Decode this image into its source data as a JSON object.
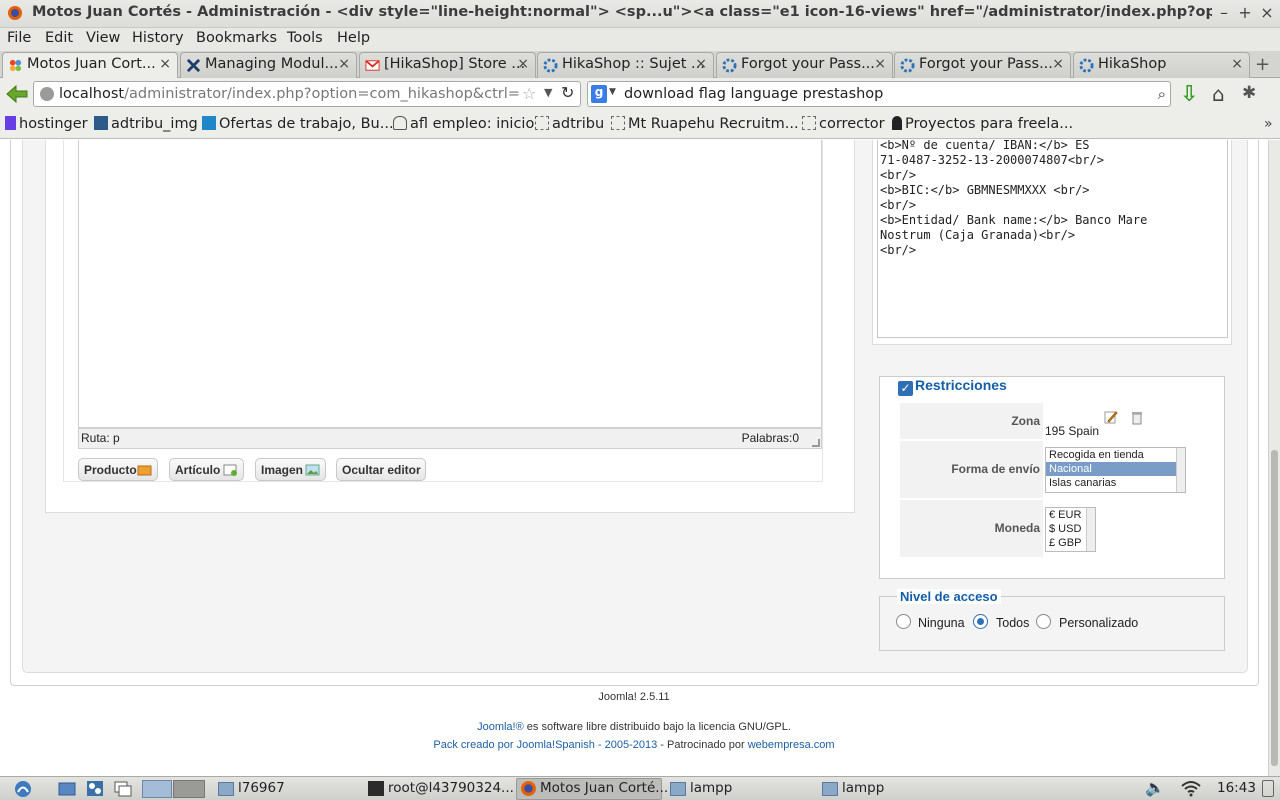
{
  "window": {
    "title": "Motos Juan Cortés - Administración - <div style=\"line-height:normal\"> <sp...u\"><a class=\"e1 icon-16-views\" href=\"/administrator/index.php?option=co",
    "minimize": "–",
    "maximize": "+",
    "close": "×"
  },
  "menu": [
    "File",
    "Edit",
    "View",
    "History",
    "Bookmarks",
    "Tools",
    "Help"
  ],
  "tabs": [
    {
      "label": "Motos Juan Cort...",
      "icon": "joomla-icon",
      "active": true
    },
    {
      "label": "Managing Modul...",
      "icon": "joomla-icon",
      "active": false
    },
    {
      "label": "[HikaShop] Store ...",
      "icon": "gmail-icon",
      "active": false
    },
    {
      "label": "HikaShop :: Sujet ...",
      "icon": "hikashop-icon",
      "active": false
    },
    {
      "label": "Forgot your Pass...",
      "icon": "hikashop-icon",
      "active": false
    },
    {
      "label": "Forgot your Pass...",
      "icon": "hikashop-icon",
      "active": false
    },
    {
      "label": "HikaShop",
      "icon": "hikashop-icon",
      "active": false
    }
  ],
  "tab_close": "×",
  "new_tab": "+",
  "nav": {
    "url_host": "localhost",
    "url_path": "/administrator/index.php?option=com_hikashop&ctrl=plug",
    "search_query": "download flag language prestashop",
    "search_engine": "g"
  },
  "bookmarks": [
    {
      "label": "hostinger",
      "icon": "hostinger-icon"
    },
    {
      "label": "adtribu_img",
      "icon": "adtribu-icon"
    },
    {
      "label": "Ofertas de trabajo, Bu...",
      "icon": "infojobs-icon"
    },
    {
      "label": "afl empleo: inicio",
      "icon": "chef-hat-icon"
    },
    {
      "label": "adtribu",
      "icon": "page-icon"
    },
    {
      "label": "Mt Ruapehu Recruitm...",
      "icon": "page-icon"
    },
    {
      "label": "corrector",
      "icon": "page-icon"
    },
    {
      "label": "Proyectos para freela...",
      "icon": "workana-icon"
    }
  ],
  "editor": {
    "path_label": "Ruta: p",
    "words_label": "Palabras:0",
    "buttons": [
      {
        "label": "Producto",
        "icon": "package-icon"
      },
      {
        "label": "Artículo",
        "icon": "article-icon"
      },
      {
        "label": "Imagen",
        "icon": "image-icon"
      },
      {
        "label": "Ocultar editor",
        "icon": ""
      }
    ]
  },
  "payment_info_code": "<br/>\n<b>Nº de cuenta/ IBAN:</b> ES\n71-0487-3252-13-2000074807<br/>\n<br/>\n<b>BIC:</b> GBMNESMMXXX <br/>\n<br/>\n<b>Entidad/ Bank name:</b> Banco Mare\nNostrum (Caja Granada)<br/>\n<br/>",
  "restricciones": {
    "title": "Restricciones",
    "checked": true,
    "zona_label": "Zona",
    "zona_value": "195 Spain",
    "forma_label": "Forma de envío",
    "forma_options": [
      "Recogida en tienda",
      "Nacional",
      "Islas canarias"
    ],
    "forma_selected": "Nacional",
    "moneda_label": "Moneda",
    "moneda_options": [
      "€ EUR",
      "$ USD",
      "£ GBP"
    ]
  },
  "nivel_acceso": {
    "title": "Nivel de acceso",
    "options": [
      "Ninguna",
      "Todos",
      "Personalizado"
    ],
    "selected": "Todos"
  },
  "footer": {
    "version": "Joomla! 2.5.11",
    "license_link": "Joomla!®",
    "license_text": " es software libre distribuido bajo la licencia GNU/GPL.",
    "pack_link": "Pack creado por Joomla!Spanish - 2005-2013",
    "sponsor_text": " - Patrocinado por ",
    "sponsor_link": "webempresa.com"
  },
  "taskbar": {
    "items": [
      "l76967",
      "root@l43790324...",
      "Motos Juan Corté...",
      "lampp",
      "lampp"
    ],
    "time": "16:43"
  }
}
